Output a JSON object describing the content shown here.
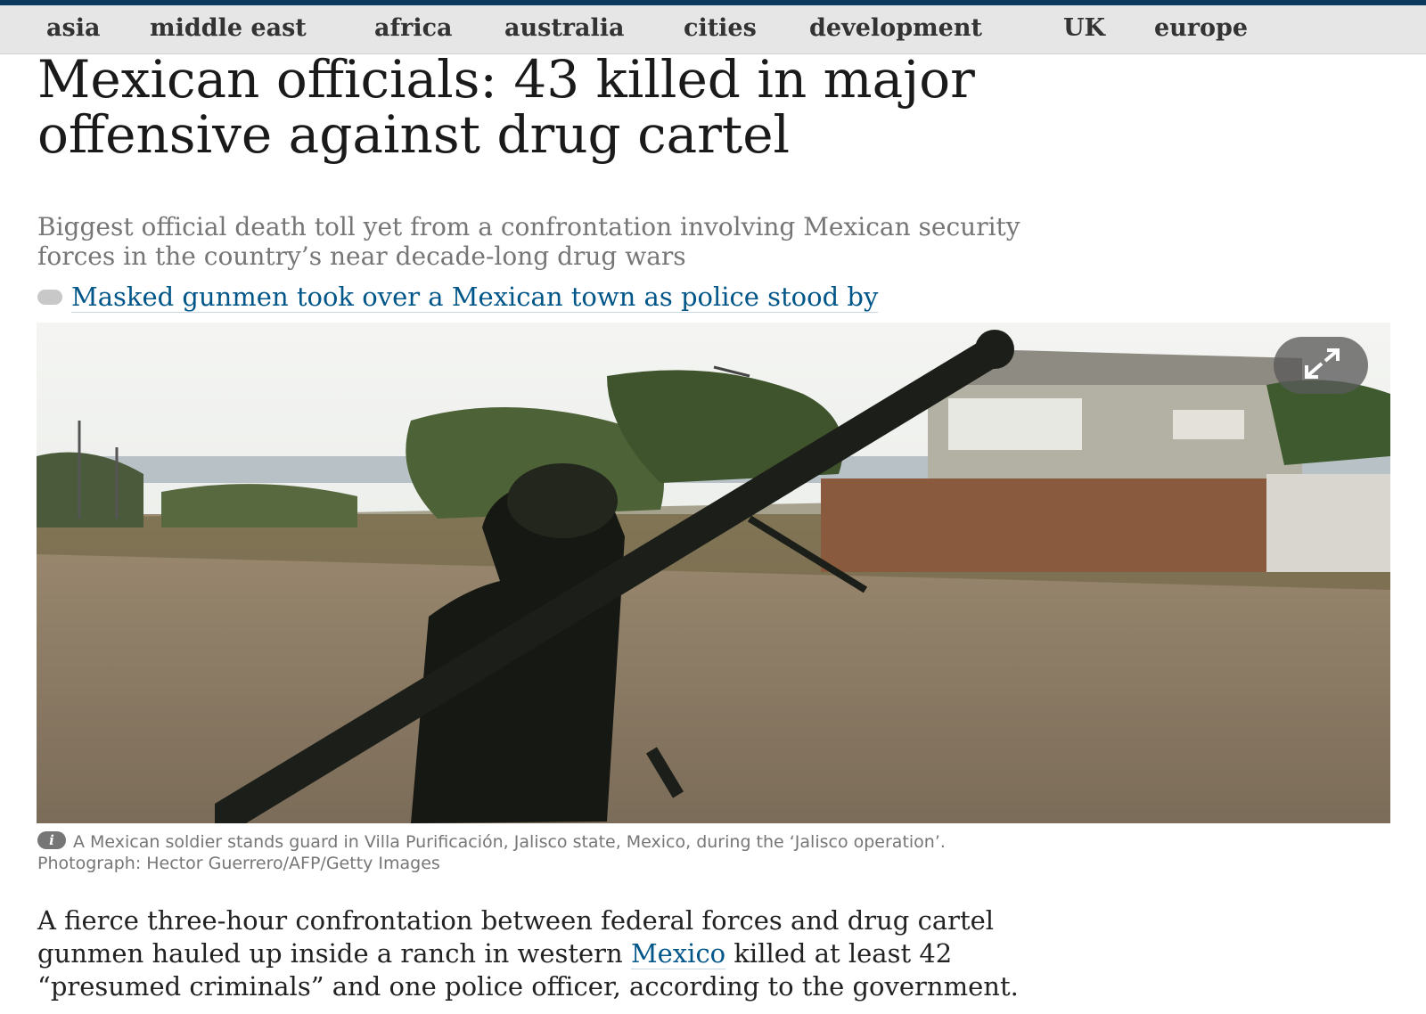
{
  "nav": {
    "items": [
      {
        "label": "asia"
      },
      {
        "label": "middle east"
      },
      {
        "label": "africa"
      },
      {
        "label": "australia"
      },
      {
        "label": "cities"
      },
      {
        "label": "development"
      },
      {
        "label": "UK"
      },
      {
        "label": "europe"
      }
    ]
  },
  "article": {
    "headline_line1": "Mexican officials: 43 killed in major",
    "headline_line2": "offensive against drug cartel",
    "standfirst_line1": "Biggest official death toll yet from a confrontation involving Mexican security",
    "standfirst_line2": "forces in the country’s near decade-long drug wars",
    "related_link": "Masked gunmen took over a Mexican town as police stood by",
    "image": {
      "icons": {
        "expand": "expand-icon",
        "info": "info-icon"
      },
      "info_glyph": "i"
    },
    "caption_line1": "A Mexican soldier stands guard in Villa Purificación, Jalisco state, Mexico, during the ‘Jalisco operation’.",
    "caption_line2": "Photograph: Hector Guerrero/AFP/Getty Images",
    "body": {
      "line1": "A fierce three-hour confrontation between federal forces and drug cartel",
      "line2_before": "gunmen hauled up inside a ranch in western ",
      "line2_link": "Mexico",
      "line2_after": " killed at least 42",
      "line3": "“presumed criminals” and one police officer, according to the government."
    }
  },
  "colors": {
    "nav_background": "#e6e6e6",
    "top_rule": "#0b3a5e",
    "link": "#005689",
    "standfirst": "#767676"
  }
}
